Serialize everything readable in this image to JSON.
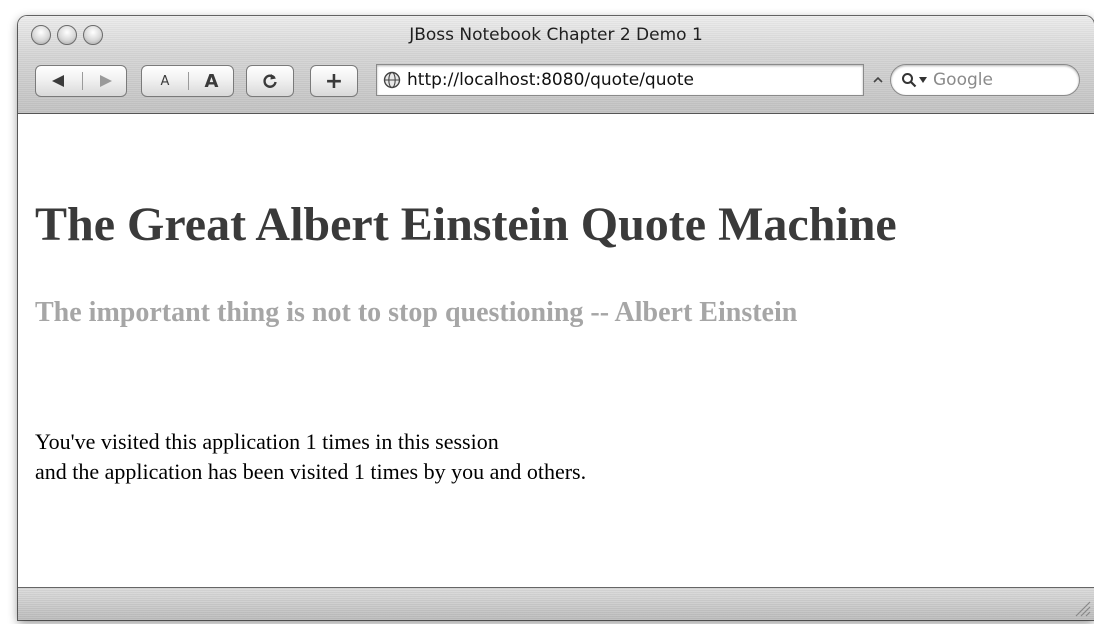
{
  "window": {
    "title": "JBoss Notebook Chapter 2 Demo 1"
  },
  "toolbar": {
    "back_icon": "back-arrow-icon",
    "forward_icon": "forward-arrow-icon",
    "text_smaller_label": "A",
    "text_bigger_label": "A",
    "reload_icon": "reload-icon",
    "add_bookmark_label": "+",
    "url": "http://localhost:8080/quote/quote",
    "search_placeholder": "Google"
  },
  "page": {
    "heading": "The Great Albert Einstein Quote Machine",
    "quote": "The important thing is not to stop questioning -- Albert Einstein",
    "visits_line1": "You've visited this application 1 times in this session",
    "visits_line2": "and the application has been visited 1 times by you and others."
  },
  "colors": {
    "heading": "#3a3a3a",
    "quote": "#a6a6a6",
    "chrome": "#c3c3c3"
  }
}
